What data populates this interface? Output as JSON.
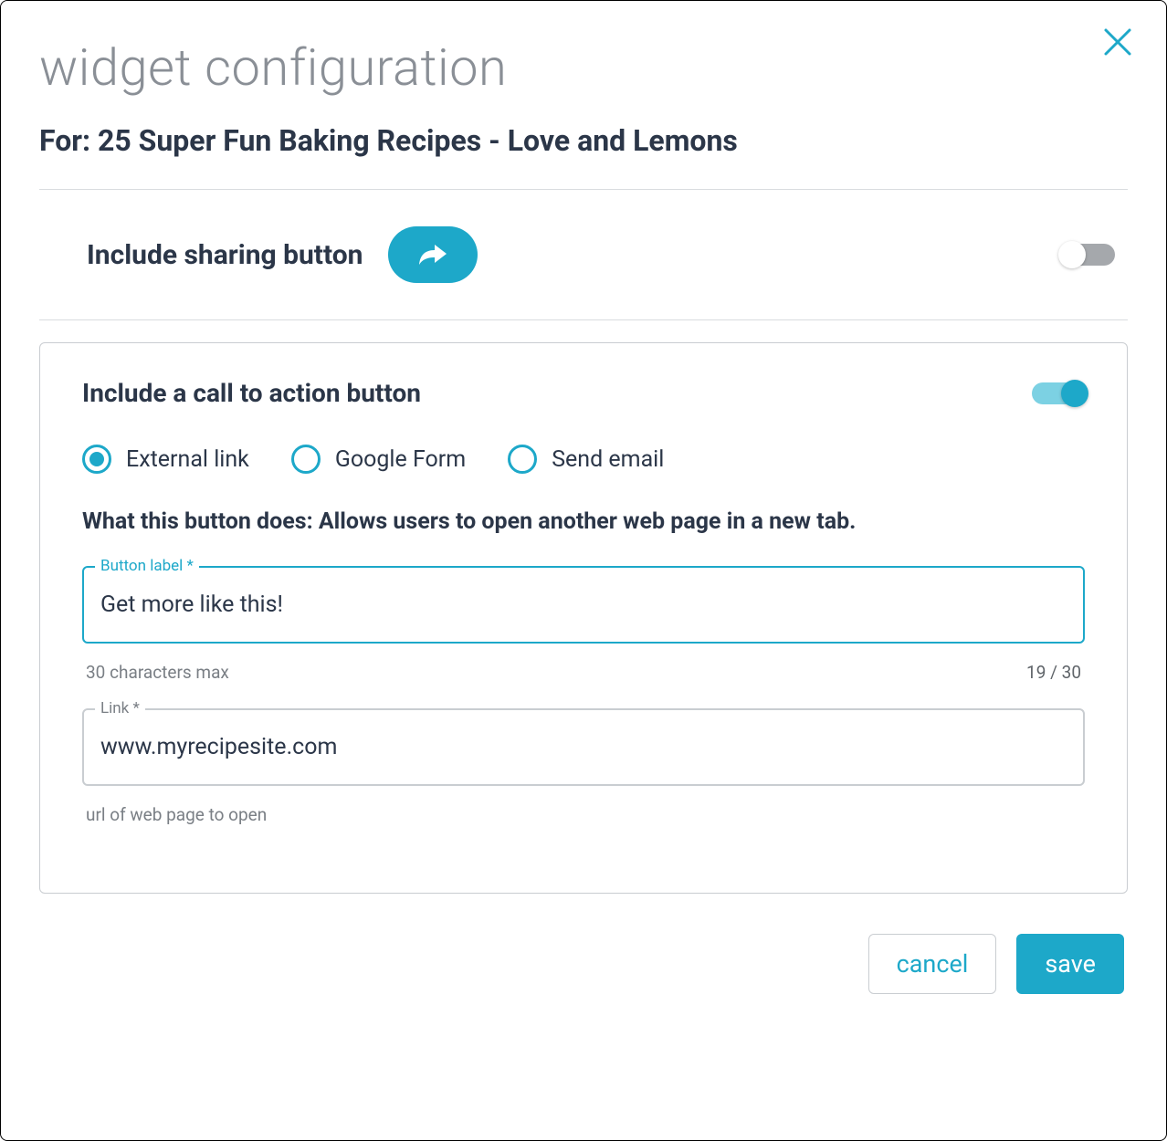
{
  "dialog": {
    "title": "widget configuration",
    "subtitle": "For: 25 Super Fun Baking Recipes - Love and Lemons"
  },
  "sharing": {
    "label": "Include sharing button",
    "enabled": false
  },
  "cta": {
    "label": "Include a call to action button",
    "enabled": true,
    "options": {
      "external": "External link",
      "google_form": "Google Form",
      "send_email": "Send email"
    },
    "selected": "external",
    "description": "What this button does: Allows users to open another web page in a new tab.",
    "button_label_field": {
      "label": "Button label *",
      "value": "Get more like this!",
      "helper": "30 characters max",
      "counter": "19 / 30"
    },
    "link_field": {
      "label": "Link *",
      "value": "www.myrecipesite.com",
      "helper": "url of web page to open"
    }
  },
  "footer": {
    "cancel": "cancel",
    "save": "save"
  }
}
